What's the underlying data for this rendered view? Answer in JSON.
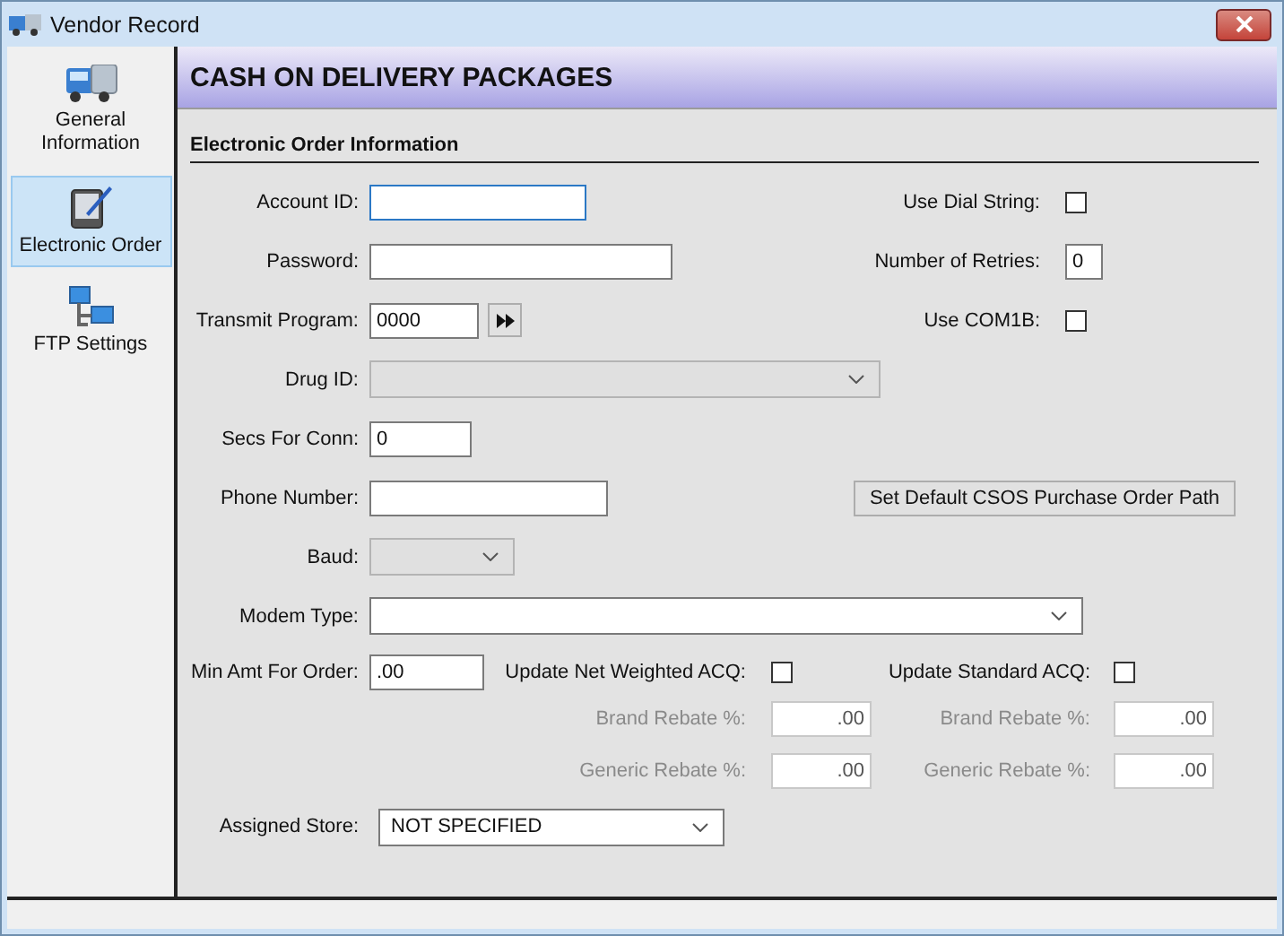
{
  "window": {
    "title": "Vendor Record"
  },
  "sidebar": {
    "items": [
      {
        "label": "General Information",
        "selected": false
      },
      {
        "label": "Electronic Order",
        "selected": true
      },
      {
        "label": "FTP Settings",
        "selected": false
      }
    ]
  },
  "header": {
    "title": "CASH ON DELIVERY PACKAGES"
  },
  "section": {
    "title": "Electronic Order Information"
  },
  "rows": [
    {
      "left": {
        "kind": "text",
        "label": "Account ID:",
        "focused": true
      },
      "right": {
        "kind": "checkbox",
        "label": "Use Dial String:",
        "checked": false
      }
    },
    {
      "left": {
        "kind": "text",
        "label": "Password:",
        "focused": false
      },
      "right": {
        "kind": "text",
        "label": "Number of Retries:",
        "value": "0"
      }
    },
    {
      "left": {
        "kind": "text-button",
        "label": "Transmit Program:",
        "value": "0000",
        "focused": false
      },
      "right": {
        "kind": "checkbox",
        "label": "Use COM1B:",
        "checked": false
      }
    },
    {
      "left": {
        "kind": "dropdown",
        "label": "Drug ID:",
        "disabled": true
      }
    },
    {
      "left": {
        "kind": "text",
        "label": "Secs For Conn:",
        "value": "0",
        "focused": false
      }
    },
    {
      "left": {
        "kind": "text",
        "label": "Phone Number:",
        "focused": false
      },
      "right": {
        "kind": "button",
        "label": "Set Default CSOS Purchase Order Path"
      }
    },
    {
      "left": {
        "kind": "dropdown",
        "label": "Baud:",
        "disabled": true
      }
    },
    {
      "left": {
        "kind": "dropdown",
        "label": "Modem Type:",
        "disabled": false
      }
    }
  ],
  "min_amount": {
    "label": "Min Amt For Order:",
    "value": ".00"
  },
  "acq_groups": [
    {
      "update": {
        "label": "Update Net Weighted ACQ:",
        "checked": false
      },
      "brand": {
        "label": "Brand Rebate %:",
        "value": ".00",
        "disabled": true
      },
      "generic": {
        "label": "Generic Rebate %:",
        "value": ".00",
        "disabled": true
      }
    },
    {
      "update": {
        "label": "Update Standard ACQ:",
        "checked": false
      },
      "brand": {
        "label": "Brand Rebate %:",
        "value": ".00",
        "disabled": true
      },
      "generic": {
        "label": "Generic Rebate %:",
        "value": ".00",
        "disabled": true
      }
    }
  ],
  "assigned_store": {
    "label": "Assigned Store:",
    "value": "NOT SPECIFIED"
  }
}
